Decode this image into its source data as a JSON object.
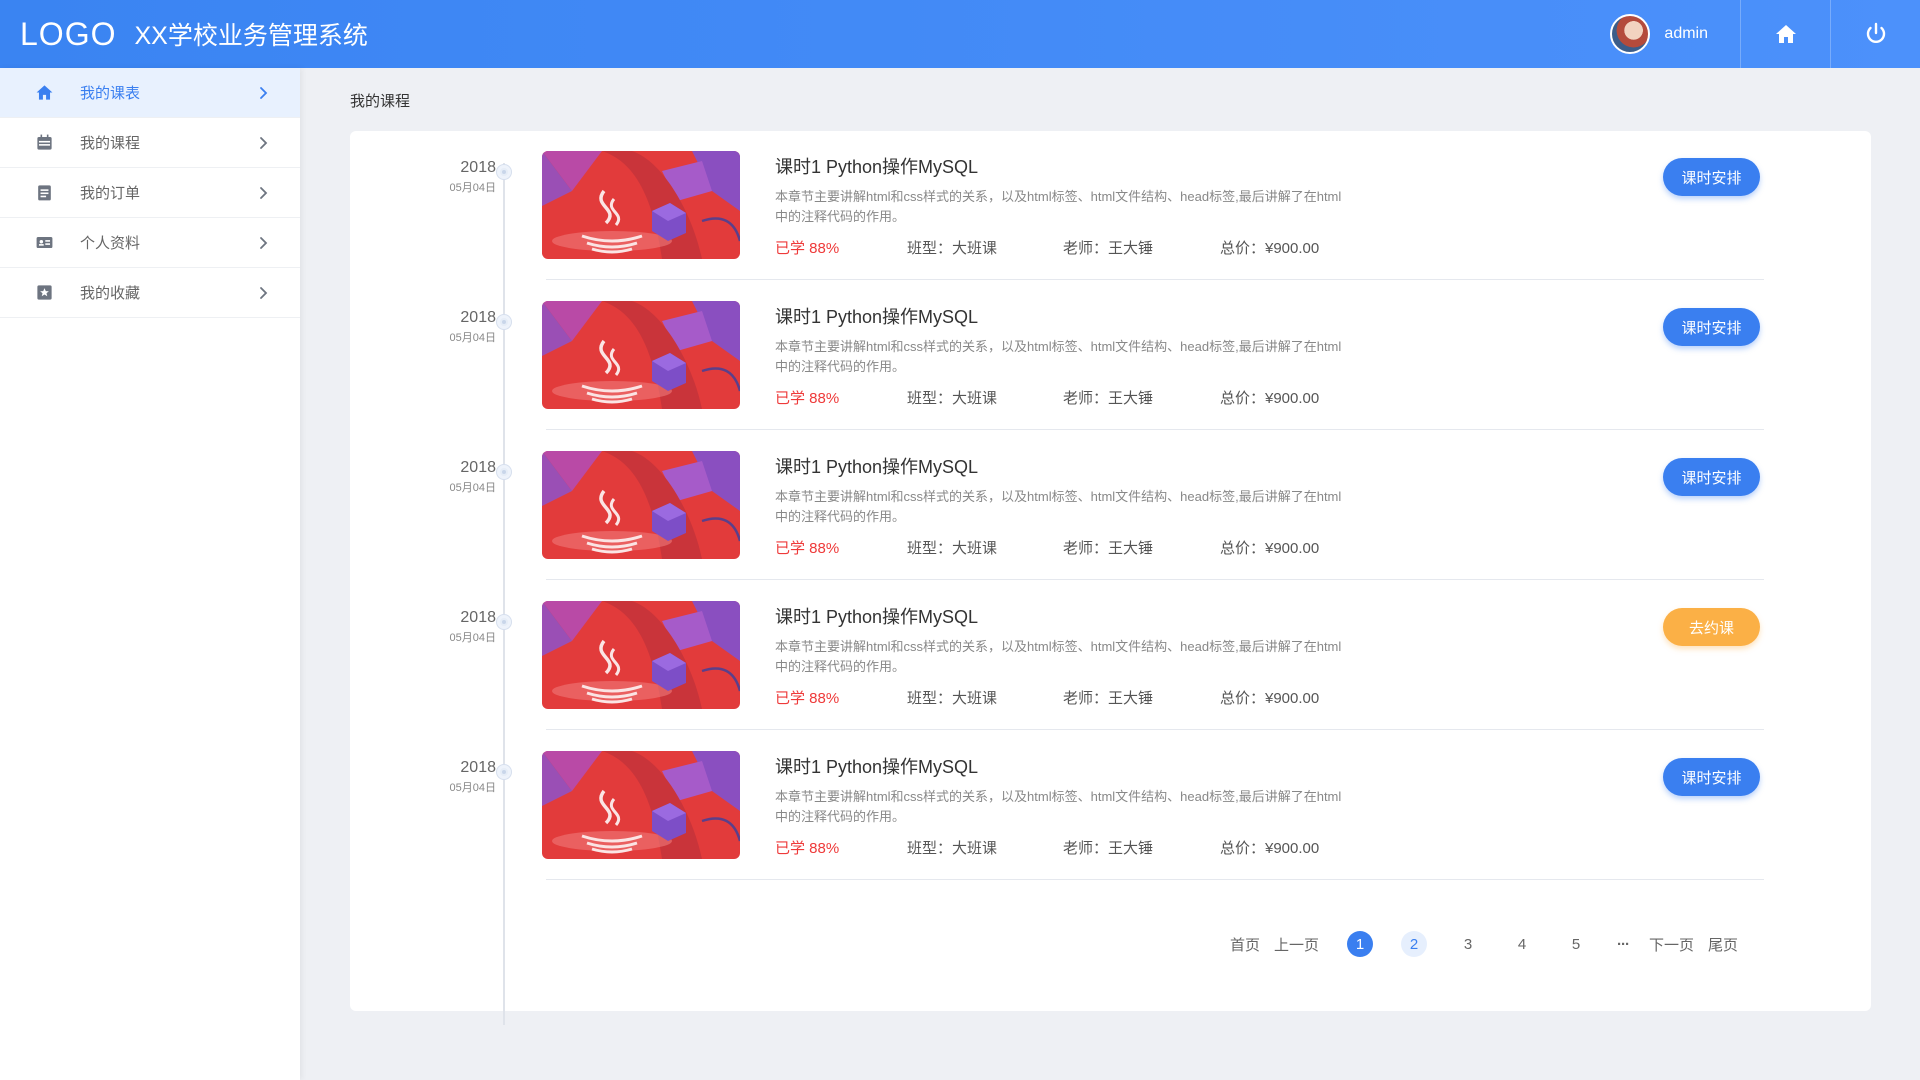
{
  "header": {
    "logo": "LOGO",
    "system_title": "XX学校业务管理系统",
    "username": "admin",
    "home_icon": "home-icon",
    "power_icon": "power-icon"
  },
  "sidebar": {
    "items": [
      {
        "label": "我的课表",
        "icon": "home-icon",
        "active": true
      },
      {
        "label": "我的课程",
        "icon": "calendar-icon",
        "active": false
      },
      {
        "label": "我的订单",
        "icon": "clipboard-icon",
        "active": false
      },
      {
        "label": "个人资料",
        "icon": "id-card-icon",
        "active": false
      },
      {
        "label": "我的收藏",
        "icon": "star-icon",
        "active": false
      }
    ]
  },
  "breadcrumb": "我的课程",
  "courses": [
    {
      "year": "2018",
      "day": "05月04日",
      "title": "课时1 Python操作MySQL",
      "desc_line1": "本章节主要讲解html和css样式的关系，以及html标签、html文件结构、head标签,最后讲解了在html",
      "desc_line2": "中的注释代码的作用。",
      "progress": "已学 88%",
      "class_type": "班型：大班课",
      "teacher": "老师：王大锤",
      "price": "总价：¥900.00",
      "button": "课时安排",
      "button_color": "blue"
    },
    {
      "year": "2018",
      "day": "05月04日",
      "title": "课时1 Python操作MySQL",
      "desc_line1": "本章节主要讲解html和css样式的关系，以及html标签、html文件结构、head标签,最后讲解了在html",
      "desc_line2": "中的注释代码的作用。",
      "progress": "已学 88%",
      "class_type": "班型：大班课",
      "teacher": "老师：王大锤",
      "price": "总价：¥900.00",
      "button": "课时安排",
      "button_color": "blue"
    },
    {
      "year": "2018",
      "day": "05月04日",
      "title": "课时1 Python操作MySQL",
      "desc_line1": "本章节主要讲解html和css样式的关系，以及html标签、html文件结构、head标签,最后讲解了在html",
      "desc_line2": "中的注释代码的作用。",
      "progress": "已学 88%",
      "class_type": "班型：大班课",
      "teacher": "老师：王大锤",
      "price": "总价：¥900.00",
      "button": "课时安排",
      "button_color": "blue"
    },
    {
      "year": "2018",
      "day": "05月04日",
      "title": "课时1 Python操作MySQL",
      "desc_line1": "本章节主要讲解html和css样式的关系，以及html标签、html文件结构、head标签,最后讲解了在html",
      "desc_line2": "中的注释代码的作用。",
      "progress": "已学 88%",
      "class_type": "班型：大班课",
      "teacher": "老师：王大锤",
      "price": "总价：¥900.00",
      "button": "去约课",
      "button_color": "orange"
    },
    {
      "year": "2018",
      "day": "05月04日",
      "title": "课时1 Python操作MySQL",
      "desc_line1": "本章节主要讲解html和css样式的关系，以及html标签、html文件结构、head标签,最后讲解了在html",
      "desc_line2": "中的注释代码的作用。",
      "progress": "已学 88%",
      "class_type": "班型：大班课",
      "teacher": "老师：王大锤",
      "price": "总价：¥900.00",
      "button": "课时安排",
      "button_color": "blue"
    }
  ],
  "pagination": {
    "first": "首页",
    "prev": "上一页",
    "pages": [
      "1",
      "2",
      "3",
      "4",
      "5"
    ],
    "current": "1",
    "ellipsis": "···",
    "next": "下一页",
    "last": "尾页"
  },
  "colors": {
    "primary": "#3a7ff0",
    "accent_orange": "#fbb046",
    "progress_red": "#ee3a3a"
  }
}
